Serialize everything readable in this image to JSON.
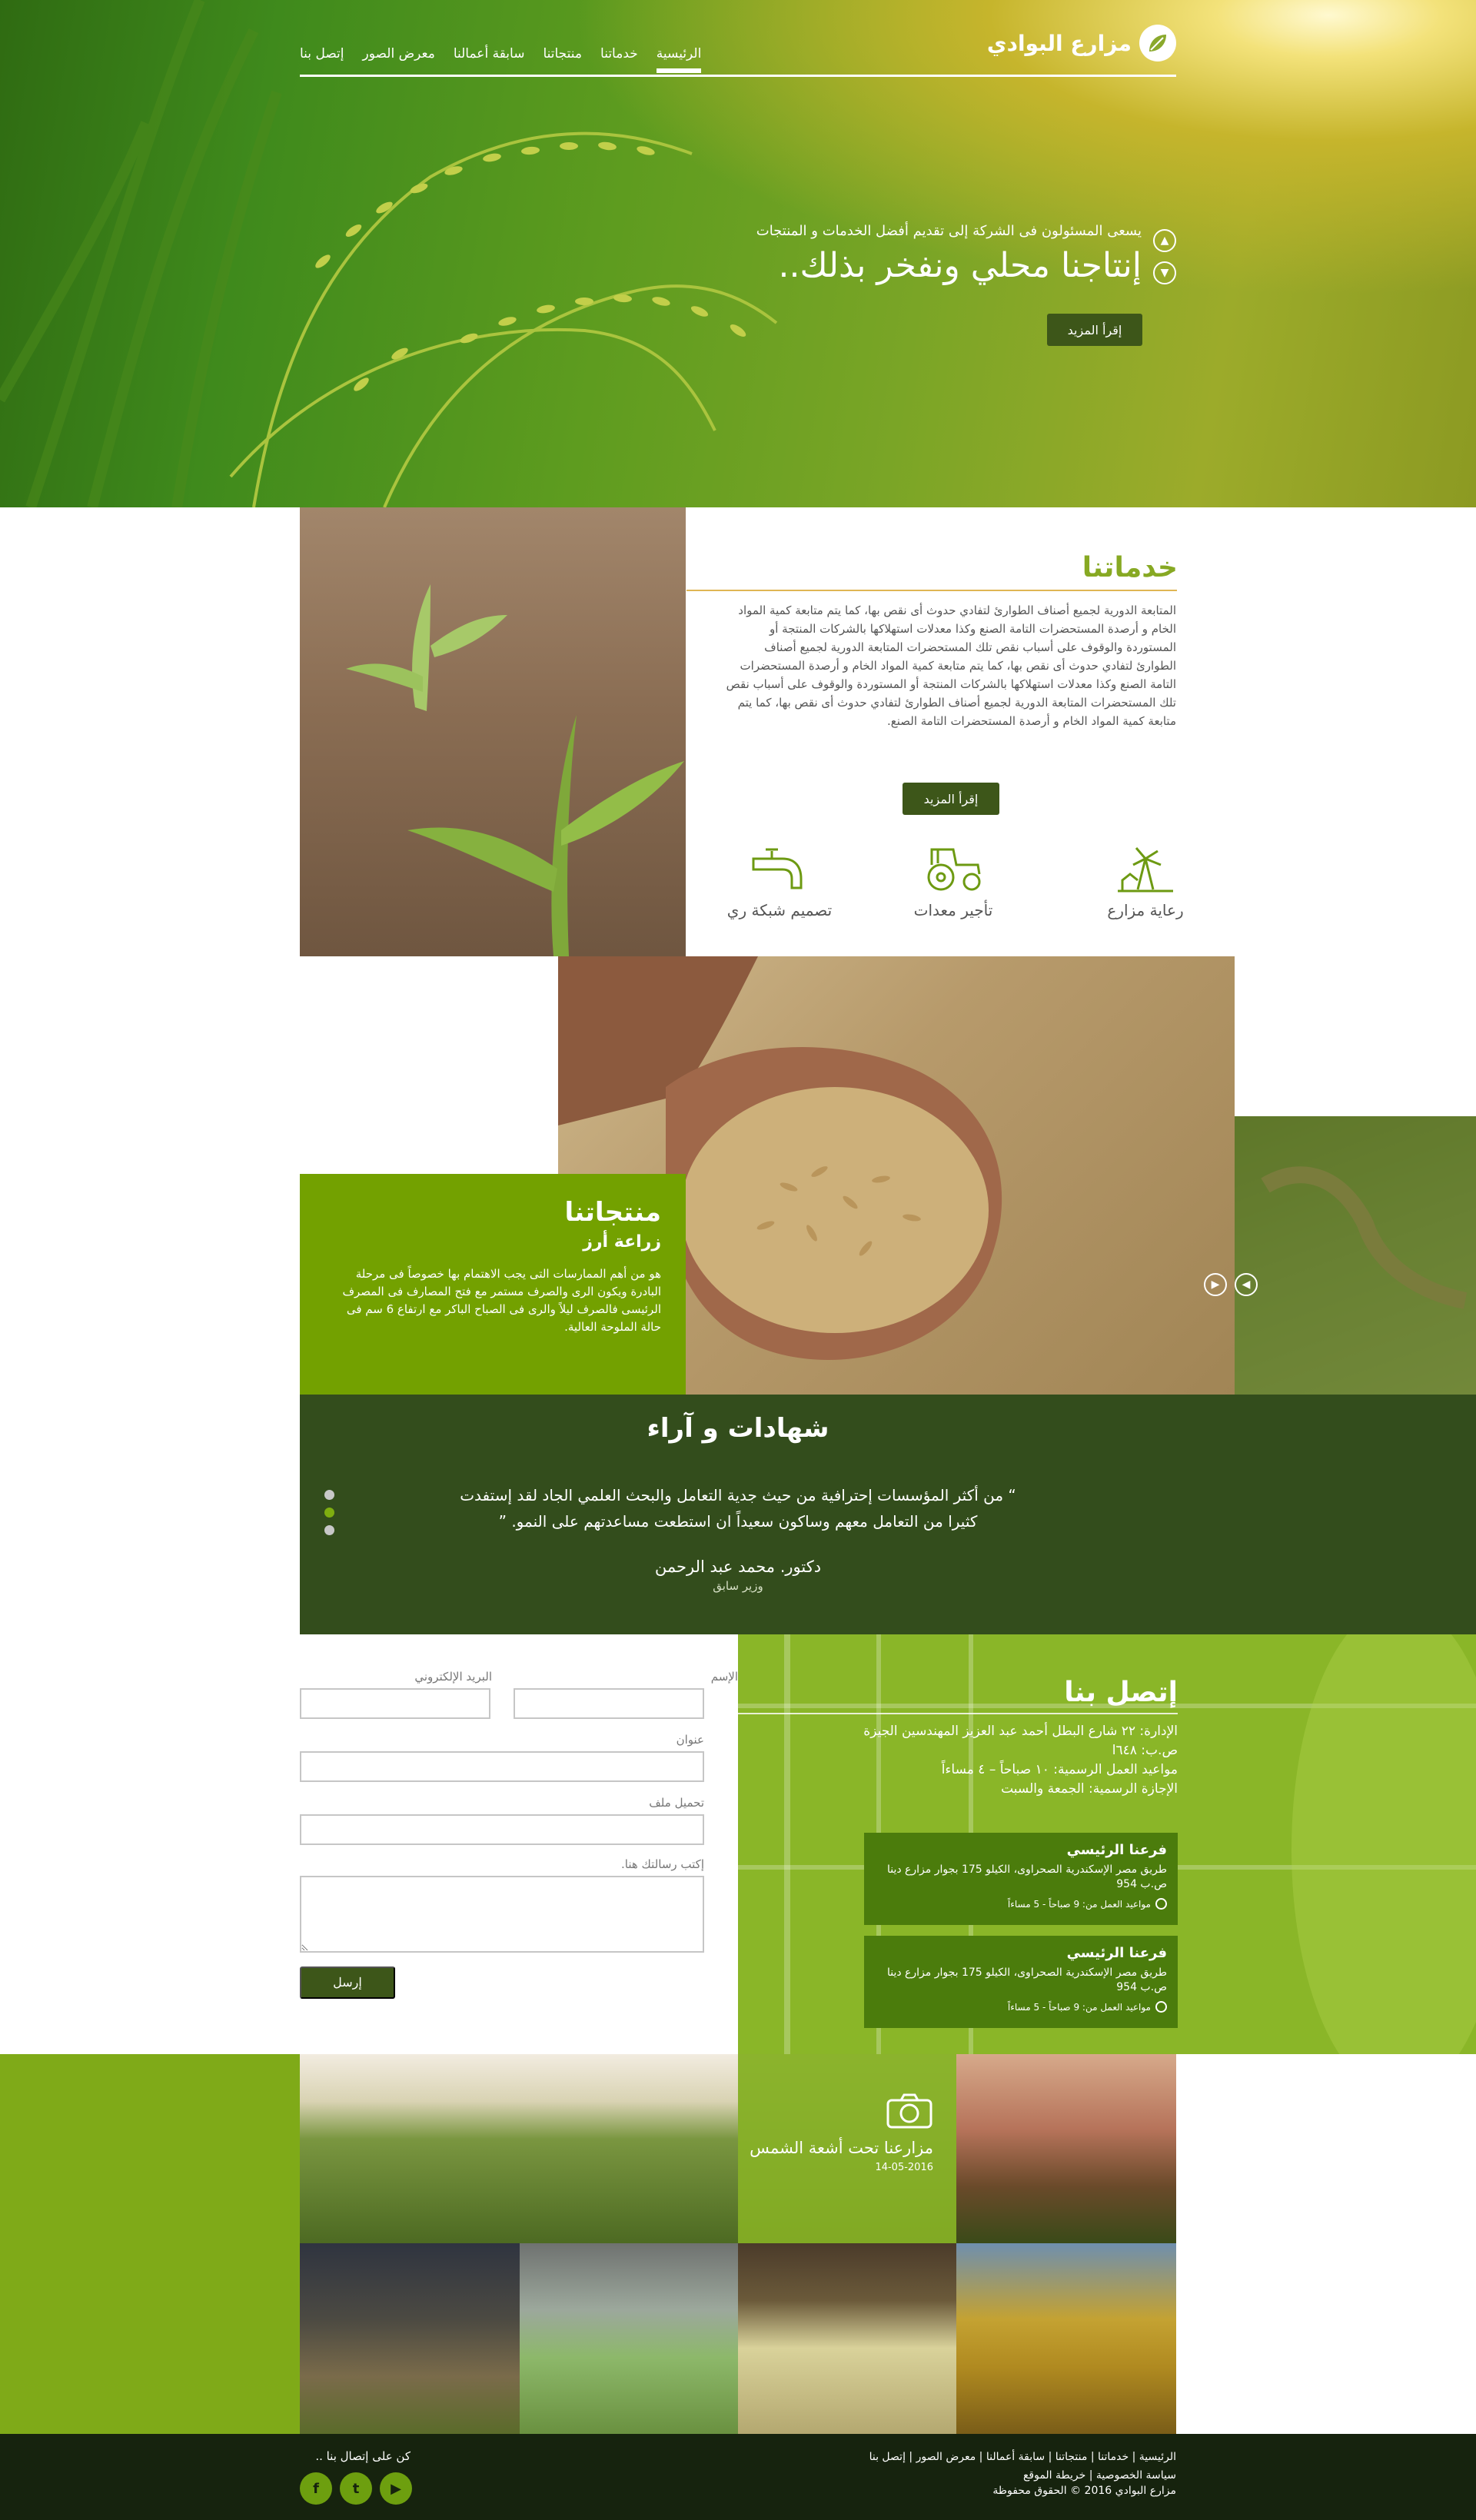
{
  "header": {
    "logo_text": "مزارع البوادي",
    "nav": [
      "الرئيسية",
      "خدماتنا",
      "منتجاتنا",
      "سابقة أعمالنا",
      "معرض الصور",
      "إتصل بنا"
    ]
  },
  "hero": {
    "subtitle": "يسعى المسئولون فى الشركة إلى تقديم أفضل الخدمات و المنتجات",
    "title": "إنتاجنا محلي ونفخر بذلك..",
    "button": "إقرأ المزيد"
  },
  "services": {
    "title": "خدماتنا",
    "text": "المتابعة الدورية لجميع أصناف الطوارئ لتفادي حدوث أى نقص بها، كما يتم متابعة كمية المواد الخام و أرصدة المستحضرات التامة الصنع وكذا معدلات استهلاكها بالشركات المنتجة أو المستوردة والوقوف على أسباب نقص تلك المستحضرات المتابعة الدورية لجميع أصناف الطوارئ لتفادي حدوث أى نقص بها، كما يتم متابعة كمية المواد الخام و أرصدة المستحضرات التامة الصنع وكذا معدلات استهلاكها بالشركات المنتجة أو المستوردة والوقوف على أسباب نقص تلك المستحضرات المتابعة الدورية لجميع أصناف الطوارئ لتفادي حدوث أى نقص بها، كما يتم متابعة كمية المواد الخام و أرصدة المستحضرات التامة الصنع.",
    "button": "إقرأ المزيد",
    "items": [
      {
        "label": "رعاية مزارع",
        "icon": "farm-windmill-icon"
      },
      {
        "label": "تأجير معدات",
        "icon": "tractor-icon"
      },
      {
        "label": "تصميم شبكة ري",
        "icon": "water-tap-icon"
      }
    ]
  },
  "products": {
    "title": "منتجاتنا",
    "subtitle": "زراعة أرز",
    "text": "هو من أهم الممارسات التى يجب الاهتمام بها خصوصاً فى مرحلة البادرة ويكون الرى والصرف مستمر مع فتح المصارف فى المصرف الرئيسى فالصرف ليلاً والرى فى الصباح الباكر مع ارتفاع 6 سم فى حالة الملوحة العالية."
  },
  "testimonials": {
    "title": "شهادات و آراء",
    "quote": "“ من أكثر المؤسسات إحترافية من حيث جدية التعامل والبحث العلمي الجاد لقد إستفدت كثيرا من التعامل معهم وساكون سعيداً ان استطعت مساعدتهم على النمو. ”",
    "author": "دكتور. محمد عبد الرحمن",
    "role": "وزير سابق"
  },
  "form": {
    "name_label": "الإسم",
    "email_label": "البريد الإلكتروني",
    "address_label": "عنوان",
    "file_label": "تحميل ملف",
    "message_label": "إكتب رسالتك هنا.",
    "send": "إرسل"
  },
  "contact": {
    "title": "إتصل بنا",
    "address": "الإدارة: ٢٢ شارع البطل أحمد عبد العزيز المهندسين الجيزة",
    "po_box": "ص.ب: ٦٤٨ا",
    "hours": "مواعيد العمل الرسمية: ١٠ صباحاً – ٤ مساءاً",
    "holiday": "الإجازة الرسمية: الجمعة والسبت",
    "branches": [
      {
        "title": "فرعنا الرئيسي",
        "address": "طريق مصر الإسكندرية الصحراوى، الكيلو 175 بجوار مزارع دينا ص.ب 954",
        "hours": "مواعيد العمل من: 9 صباحاً - 5 مساءاً"
      },
      {
        "title": "فرعنا الرئيسي",
        "address": "طريق مصر الإسكندرية الصحراوى، الكيلو 175 بجوار مزارع دينا ص.ب 954",
        "hours": "مواعيد العمل من: 9 صباحاً - 5 مساءاً"
      }
    ]
  },
  "gallery": {
    "feature_title": "مزارعنا تحت أشعة الشمس",
    "feature_date": "14-05-2016"
  },
  "footer": {
    "links_row1": "الرئيسية | خدماتنا | منتجاتنا | سابقة أعمالنا | معرض الصور | إتصل بنا",
    "links_row2": "سياسة الخصوصية | خريطة الموقع",
    "copyright": "مزارع البوادي 2016 © الحقوق محفوظة",
    "call": "كن على إتصال بنا ..",
    "social": [
      "facebook-icon",
      "twitter-icon",
      "youtube-icon"
    ]
  }
}
